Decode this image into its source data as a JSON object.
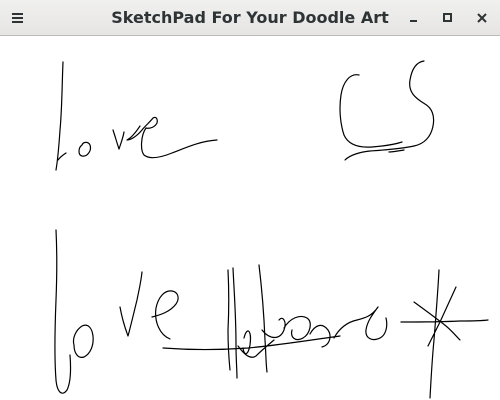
{
  "window": {
    "title": "SketchPad For Your Doodle Art",
    "background": "#ffffff",
    "stroke_color": "#000000"
  },
  "titlebar": {
    "menu_icon": "hamburger-menu-icon",
    "minimize_icon": "minimize-icon",
    "maximize_icon": "maximize-icon",
    "close_icon": "close-icon"
  }
}
